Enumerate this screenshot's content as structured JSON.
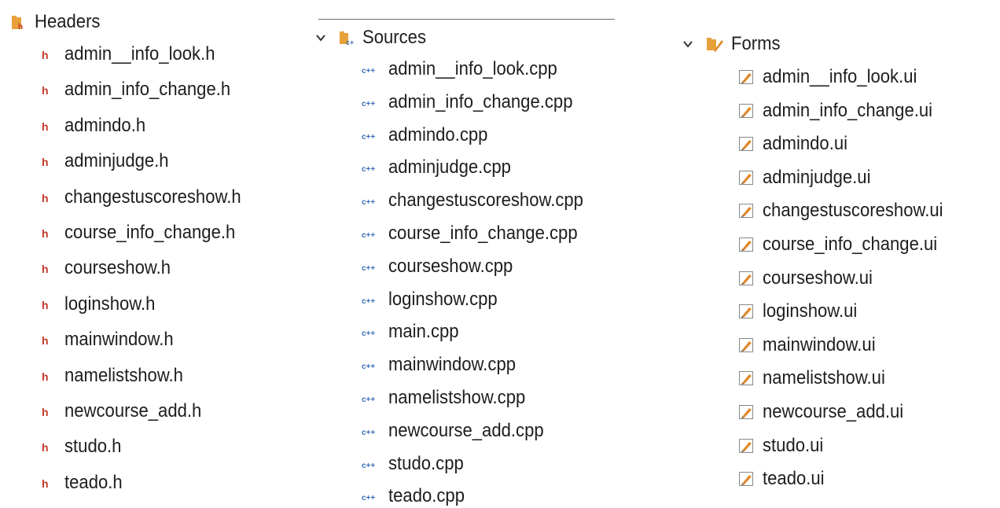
{
  "headers": {
    "title": "Headers",
    "icon": "header-folder-icon",
    "items": [
      "admin__info_look.h",
      "admin_info_change.h",
      "admindo.h",
      "adminjudge.h",
      "changestuscoreshow.h",
      "course_info_change.h",
      "courseshow.h",
      "loginshow.h",
      "mainwindow.h",
      "namelistshow.h",
      "newcourse_add.h",
      "studo.h",
      "teado.h"
    ]
  },
  "sources": {
    "title": "Sources",
    "icon": "source-folder-icon",
    "items": [
      "admin__info_look.cpp",
      "admin_info_change.cpp",
      "admindo.cpp",
      "adminjudge.cpp",
      "changestuscoreshow.cpp",
      "course_info_change.cpp",
      "courseshow.cpp",
      "loginshow.cpp",
      "main.cpp",
      "mainwindow.cpp",
      "namelistshow.cpp",
      "newcourse_add.cpp",
      "studo.cpp",
      "teado.cpp"
    ]
  },
  "forms": {
    "title": "Forms",
    "icon": "forms-folder-icon",
    "items": [
      "admin__info_look.ui",
      "admin_info_change.ui",
      "admindo.ui",
      "adminjudge.ui",
      "changestuscoreshow.ui",
      "course_info_change.ui",
      "courseshow.ui",
      "loginshow.ui",
      "mainwindow.ui",
      "namelistshow.ui",
      "newcourse_add.ui",
      "studo.ui",
      "teado.ui"
    ]
  },
  "colors": {
    "header_icon": "#c0392b",
    "cpp_icon": "#3b6fb6",
    "form_icon": "#e0892c",
    "folder": "#e8a13a"
  }
}
